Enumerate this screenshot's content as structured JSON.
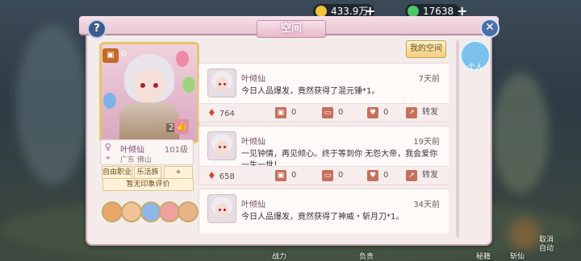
{
  "resources": {
    "gold": "433.9万",
    "gems": "17638"
  },
  "panel": {
    "title": "空间",
    "my_space_button": "我的空间",
    "help": "?",
    "close": "✕"
  },
  "side": {
    "avatar_label": "个人"
  },
  "profile": {
    "badge_count": "0",
    "likes": "2",
    "name": "叶倾仙",
    "level": "101级",
    "location": "广东 佛山",
    "tags": [
      "自由职业",
      "乐活族",
      "+"
    ],
    "impression": "暂无印象评价"
  },
  "feed": {
    "posts": [
      {
        "author": "叶倾仙",
        "time": "7天前",
        "content": "今日人品爆发，竟然获得了混元锤*1。",
        "heat": "764",
        "gifts": "0",
        "comments": "0",
        "likes": "0",
        "share": "转发"
      },
      {
        "author": "叶倾仙",
        "time": "19天前",
        "content": "一见钟情，再见倾心。终于等到你 无怨大帝，我会爱你一生一世！",
        "heat": "658",
        "gifts": "0",
        "comments": "0",
        "likes": "0",
        "share": "转发"
      },
      {
        "author": "叶倾仙",
        "time": "34天前",
        "content": "今日人品爆发，竟然获得了神威・斩月刀*1。",
        "heat": "",
        "gifts": "",
        "comments": "",
        "likes": "",
        "share": ""
      }
    ]
  },
  "background_labels": {
    "cancel_auto": "取消\n自动",
    "bottom_a": "战力",
    "bottom_b": "负责",
    "bottom_c": "秘籍",
    "bottom_d": "斩仙"
  },
  "colors": {
    "panel_bg": "#f3ecea",
    "accent_pink": "#e7b9c9",
    "gold_button": "#f2cf7e"
  }
}
